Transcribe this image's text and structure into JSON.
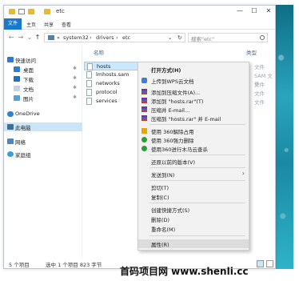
{
  "window": {
    "title": "etc",
    "minimize": "—",
    "maximize": "☐",
    "close": "✕"
  },
  "ribbon": {
    "file_tab": "文件",
    "tabs": [
      "主页",
      "共享",
      "查看"
    ]
  },
  "address": {
    "back": "←",
    "forward": "→",
    "recent": "⌄",
    "up": "↑",
    "chevron": "«",
    "crumbs": [
      "system32",
      "drivers",
      "etc"
    ],
    "separator": "›",
    "dropdown": "⌄",
    "refresh": "↻",
    "search_placeholder": "搜索\"etc\""
  },
  "sidebar": {
    "items": [
      {
        "label": "快速访问",
        "pinned": false
      },
      {
        "label": "桌面",
        "pinned": true
      },
      {
        "label": "下载",
        "pinned": true
      },
      {
        "label": "文档",
        "pinned": true
      },
      {
        "label": "图片",
        "pinned": true
      },
      {
        "label": "OneDrive",
        "pinned": false
      },
      {
        "label": "此电脑",
        "pinned": false,
        "selected": true
      },
      {
        "label": "网络",
        "pinned": false
      },
      {
        "label": "家庭组",
        "pinned": false
      }
    ],
    "pin_glyph": "✱"
  },
  "columns": {
    "name": "名称",
    "type": "类型"
  },
  "files": [
    "hosts",
    "lmhosts.sam",
    "networks",
    "protocol",
    "services"
  ],
  "type_column_partial": [
    "文件",
    "SAM 文件",
    "文件",
    "文件",
    "文件"
  ],
  "context_menu": {
    "items": [
      {
        "label": "打开方式(H)",
        "bold": true
      },
      {
        "label": "上传到WPS云文档"
      },
      {
        "label": "添加到压缩文件(A)..."
      },
      {
        "label": "添加到 \"hosts.rar\"(T)"
      },
      {
        "label": "压缩并 E-mail..."
      },
      {
        "label": "压缩到 \"hosts.rar\" 并 E-mail"
      },
      {
        "label": "使用 360解除占用"
      },
      {
        "label": "使用 360强力删除"
      },
      {
        "label": "使用360进行木马云查杀"
      },
      {
        "label": "还原以前的版本(V)"
      },
      {
        "label": "发送到(N)",
        "submenu": true
      },
      {
        "label": "剪切(T)"
      },
      {
        "label": "复制(C)"
      },
      {
        "label": "创建快捷方式(S)"
      },
      {
        "label": "删除(D)"
      },
      {
        "label": "重命名(M)"
      },
      {
        "label": "属性(R)",
        "hover": true
      }
    ],
    "submenu_arrow": "›"
  },
  "status": {
    "count": "5 个项目",
    "selected": "选中 1 个项目 823 字节"
  },
  "watermark": "首码项目网 www.shenli.cc"
}
